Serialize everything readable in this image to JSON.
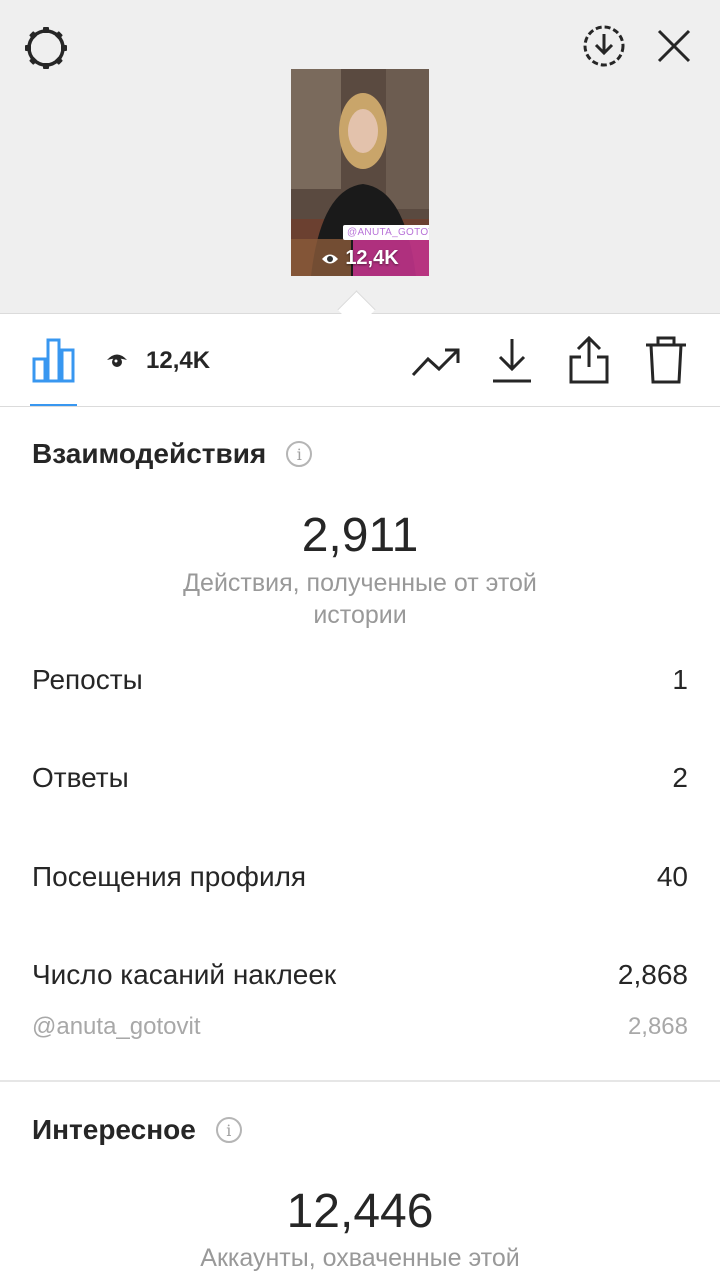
{
  "header": {
    "settings_icon": "gear-icon",
    "download_icon": "circle-download-icon",
    "close_icon": "close-icon"
  },
  "story_thumbnail": {
    "sticker_text": "@ANUTA_GOTOVIT",
    "views": "12,4K"
  },
  "tabbar": {
    "insights_icon": "bar-chart-icon",
    "views_icon": "eye-icon",
    "view_count": "12,4K",
    "actions": [
      "trend-icon",
      "download-icon",
      "share-icon",
      "trash-icon"
    ],
    "accent_color": "#3897f0"
  },
  "interactions": {
    "title": "Взаимодействия",
    "total": "2,911",
    "caption": "Действия, полученные от этой истории",
    "rows": [
      {
        "label": "Репосты",
        "value": "1"
      },
      {
        "label": "Ответы",
        "value": "2"
      },
      {
        "label": "Посещения профиля",
        "value": "40"
      },
      {
        "label": "Число касаний наклеек",
        "value": "2,868"
      }
    ],
    "sub_row": {
      "label": "@anuta_gotovit",
      "value": "2,868"
    }
  },
  "discovery": {
    "title": "Интересное",
    "total": "12,446",
    "caption": "Аккаунты, охваченные этой"
  }
}
